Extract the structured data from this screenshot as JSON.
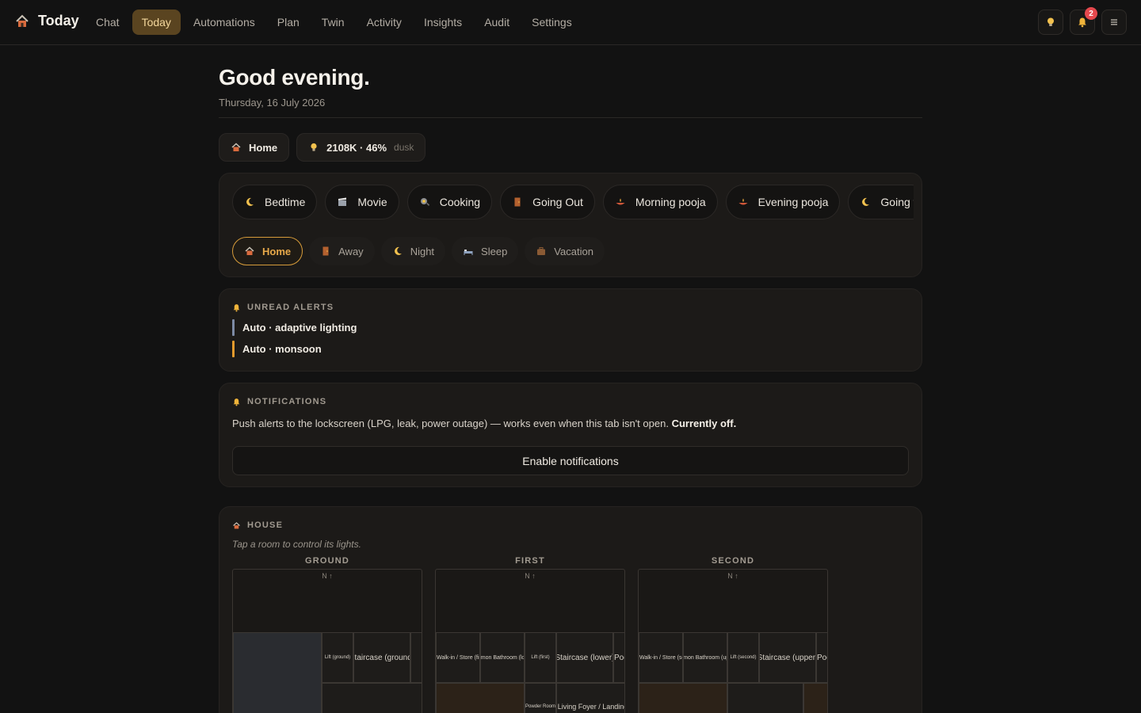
{
  "app": {
    "title": "Today"
  },
  "nav": {
    "items": [
      "Chat",
      "Today",
      "Automations",
      "Plan",
      "Twin",
      "Activity",
      "Insights",
      "Audit",
      "Settings"
    ],
    "active": "Today"
  },
  "header": {
    "notification_count": "2"
  },
  "greeting": "Good evening.",
  "date": "Thursday, 16 July 2026",
  "status": {
    "location": "Home",
    "lighting": "2108K · 46%",
    "phase": "dusk"
  },
  "scenes": [
    "Bedtime",
    "Movie",
    "Cooking",
    "Going Out",
    "Morning pooja",
    "Evening pooja",
    "Going t"
  ],
  "modes": [
    "Home",
    "Away",
    "Night",
    "Sleep",
    "Vacation"
  ],
  "active_mode": "Home",
  "alerts": {
    "heading": "UNREAD ALERTS",
    "items": [
      {
        "text": "Auto · adaptive lighting",
        "color": "#7c8aa5"
      },
      {
        "text": "Auto · monsoon",
        "color": "#e39a2d"
      }
    ]
  },
  "notifications": {
    "heading": "NOTIFICATIONS",
    "text": "Push alerts to the lockscreen (LPG, leak, power outage) — works even when this tab isn't open.",
    "state": "Currently off.",
    "button": "Enable notifications"
  },
  "house": {
    "heading": "HOUSE",
    "hint": "Tap a room to control its lights.",
    "compass": "N ↑",
    "floors": [
      {
        "name": "GROUND",
        "rooms": [
          "Lift (ground)",
          "Staircase (ground)"
        ]
      },
      {
        "name": "FIRST",
        "rooms": [
          "Walk-in / Store (first)",
          "Common Bathroom (lower)",
          "Lift (first)",
          "Staircase (lower)",
          "Pooja (N-",
          "Powder Room",
          "Living Foyer / Landing"
        ]
      },
      {
        "name": "SECOND",
        "rooms": [
          "Walk-in / Store (second)",
          "Common Bathroom (upper)",
          "Lift (second)",
          "Staircase (upper)",
          "Pooja (S"
        ]
      }
    ]
  },
  "colors": {
    "accent": "#d69b3a",
    "nav_active_bg": "#5a4420",
    "badge": "#e5484d"
  }
}
